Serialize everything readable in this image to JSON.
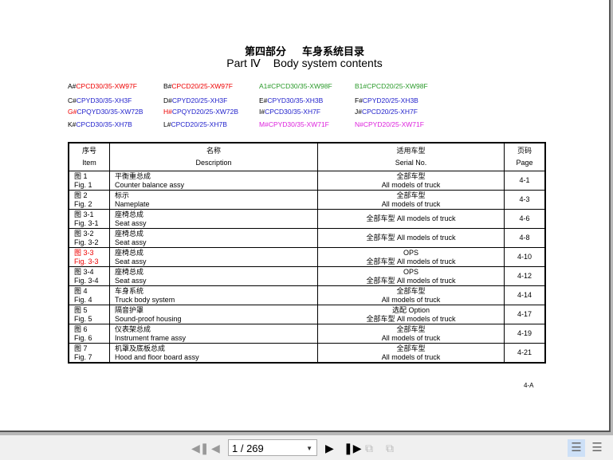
{
  "title": {
    "cn_part": "第四部分",
    "cn_name": "车身系统目录",
    "en_part": "Part Ⅳ",
    "en_name": "Body system contents"
  },
  "codes": [
    [
      {
        "p": "A#",
        "s": "CPCD30/35-XW97F",
        "pc": "#000",
        "sc": "#e00"
      },
      {
        "p": "B#",
        "s": "CPCD20/25-XW97F",
        "pc": "#000",
        "sc": "#e00"
      },
      {
        "p": "A1#",
        "s": "CPCD30/35-XW98F",
        "pc": "#2a9a2a",
        "sc": "#2a9a2a"
      },
      {
        "p": "B1#",
        "s": "CPCD20/25-XW98F",
        "pc": "#2a9a2a",
        "sc": "#2a9a2a"
      }
    ],
    [
      {
        "p": "C#",
        "s": "CPYD30/35-XH3F",
        "pc": "#000",
        "sc": "#22c"
      },
      {
        "p": "D#",
        "s": "CPYD20/25-XH3F",
        "pc": "#000",
        "sc": "#22c"
      },
      {
        "p": "E#",
        "s": "CPYD30/35-XH3B",
        "pc": "#000",
        "sc": "#22c"
      },
      {
        "p": "F#",
        "s": "CPYD20/25-XH3B",
        "pc": "#000",
        "sc": "#22c"
      }
    ],
    [
      {
        "p": "G#",
        "s": "CPQYD30/35-XW72B",
        "pc": "#e00",
        "sc": "#22c"
      },
      {
        "p": "H#",
        "s": "CPQYD20/25-XW72B",
        "pc": "#e00",
        "sc": "#22c"
      },
      {
        "p": "I#",
        "s": "CPCD30/35-XH7F",
        "pc": "#000",
        "sc": "#22c"
      },
      {
        "p": "J#",
        "s": "CPCD20/25-XH7F",
        "pc": "#000",
        "sc": "#22c"
      }
    ],
    [
      {
        "p": "K#",
        "s": "CPCD30/35-XH7B",
        "pc": "#000",
        "sc": "#22c"
      },
      {
        "p": "L#",
        "s": "CPCD20/25-XH7B",
        "pc": "#000",
        "sc": "#22c"
      },
      {
        "p": "M#",
        "s": "CPYD30/35-XW71F",
        "pc": "#d2d",
        "sc": "#d2d"
      },
      {
        "p": "N#",
        "s": "CPYD20/25-XW71F",
        "pc": "#d2d",
        "sc": "#d2d"
      }
    ]
  ],
  "table": {
    "headers": [
      {
        "cn": "序号",
        "en": "Item"
      },
      {
        "cn": "名称",
        "en": "Description"
      },
      {
        "cn": "适用车型",
        "en": "Serial No."
      },
      {
        "cn": "页码",
        "en": "Page"
      }
    ],
    "rows": [
      {
        "item_cn": "图 1",
        "item_en": "Fig. 1",
        "desc_cn": "平衡重总成",
        "desc_en": "Counter balance assy",
        "serial1": "全部车型",
        "serial2": "All models of truck",
        "page": "4-1"
      },
      {
        "item_cn": "图 2",
        "item_en": "Fig. 2",
        "desc_cn": "标示",
        "desc_en": "Nameplate",
        "serial1": "全部车型",
        "serial2": "All models of truck",
        "page": "4-3"
      },
      {
        "item_cn": "图 3-1",
        "item_en": "Fig. 3-1",
        "desc_cn": "座椅总成",
        "desc_en": "Seat assy",
        "serial1": "全部车型 All models of truck",
        "serial2": "",
        "page": "4-6"
      },
      {
        "item_cn": "图 3-2",
        "item_en": "Fig. 3-2",
        "desc_cn": "座椅总成",
        "desc_en": "Seat assy",
        "serial1": "全部车型 All models of truck",
        "serial2": "",
        "page": "4-8"
      },
      {
        "item_cn": "图 3-3",
        "item_en": "Fig. 3-3",
        "desc_cn": "座椅总成",
        "desc_en": "Seat assy",
        "serial1": "OPS",
        "serial2": "全部车型 All models of truck",
        "page": "4-10",
        "red": true
      },
      {
        "item_cn": "图 3-4",
        "item_en": "Fig. 3-4",
        "desc_cn": "座椅总成",
        "desc_en": "Seat assy",
        "serial1": "OPS",
        "serial2": "全部车型 All models of truck",
        "page": "4-12"
      },
      {
        "item_cn": "图 4",
        "item_en": "Fig. 4",
        "desc_cn": "车身系统",
        "desc_en": "Truck body system",
        "serial1": "全部车型",
        "serial2": "All models of truck",
        "page": "4-14"
      },
      {
        "item_cn": "图 5",
        "item_en": "Fig. 5",
        "desc_cn": "隔音护罩",
        "desc_en": "Sound-proof housing",
        "serial1": "选配 Option",
        "serial2": "全部车型  All models of truck",
        "page": "4-17"
      },
      {
        "item_cn": "图 6",
        "item_en": "Fig. 6",
        "desc_cn": "仪表架总成",
        "desc_en": "Instrument frame assy",
        "serial1": "全部车型",
        "serial2": "All models of truck",
        "page": "4-19"
      },
      {
        "item_cn": "图 7",
        "item_en": "Fig. 7",
        "desc_cn": "机罩及底板总成",
        "desc_en": "Hood and floor board assy",
        "serial1": "全部车型",
        "serial2": "All models of truck",
        "page": "4-21"
      }
    ]
  },
  "page_footer": "4-A",
  "toolbar": {
    "page_value": "1 / 269"
  }
}
